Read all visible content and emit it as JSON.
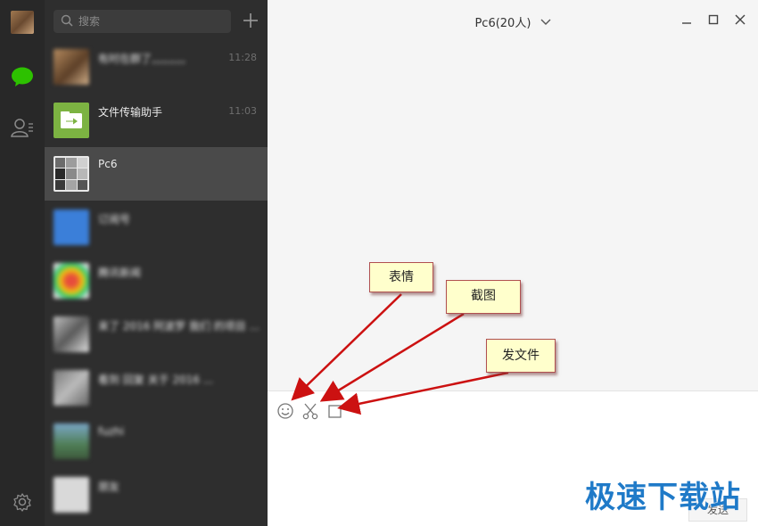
{
  "search": {
    "placeholder": "搜索"
  },
  "conversations": [
    {
      "name": "有时在群了,,,,,,,,,,",
      "time": "11:28",
      "blurred": true
    },
    {
      "name": "文件传输助手",
      "time": "11:03",
      "blurred": false
    },
    {
      "name": "Pc6",
      "time": "",
      "blurred": false,
      "active": true
    },
    {
      "name": "订阅号",
      "time": "",
      "blurred": true
    },
    {
      "name": "腾讯新闻",
      "time": "",
      "blurred": true
    },
    {
      "name": "来了 2016 阿波罗 我们 的项目 ...",
      "time": "",
      "blurred": true
    },
    {
      "name": "看到 回复 关于 2016 ...",
      "time": "",
      "blurred": true
    },
    {
      "name": "fuzhi",
      "time": "",
      "blurred": true
    },
    {
      "name": "朋友",
      "time": "",
      "blurred": true
    }
  ],
  "chat": {
    "title": "Pc6(20人)",
    "send_label": "发送"
  },
  "callouts": {
    "emoji": "表情",
    "screenshot": "截图",
    "file": "发文件"
  },
  "watermark": "极速下载站",
  "icons": {
    "rail": [
      "avatar",
      "chat-icon",
      "contacts-icon",
      "settings-icon"
    ],
    "toolbar": [
      "emoji-icon",
      "scissors-icon",
      "file-icon"
    ],
    "window": [
      "minimize-icon",
      "maximize-icon",
      "close-icon"
    ]
  },
  "colors": {
    "accent_green": "#2dc100",
    "callout_bg": "#ffffcc",
    "arrow_red": "#cc1111",
    "watermark_blue": "#1f7ac8"
  }
}
